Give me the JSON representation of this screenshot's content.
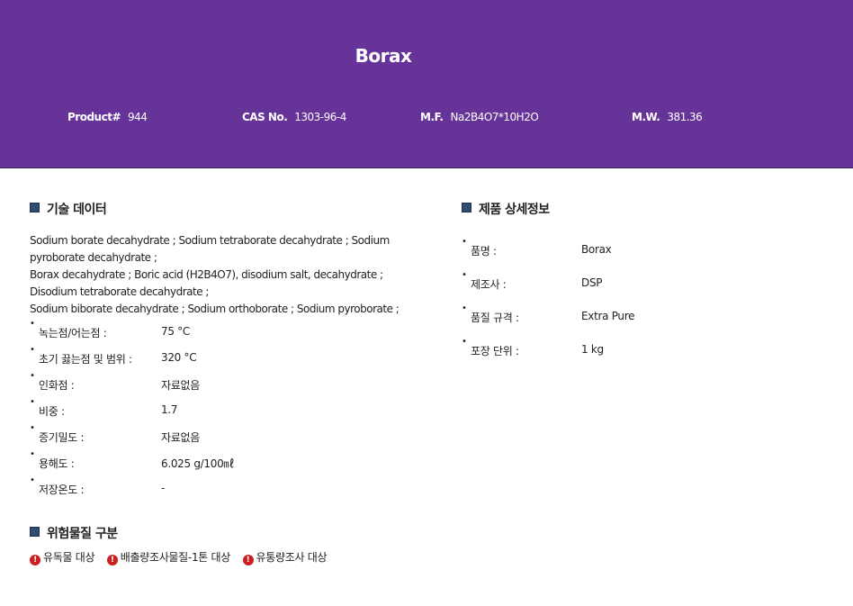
{
  "header": {
    "title": "Borax",
    "product_label": "Product#",
    "product_value": "944",
    "cas_label": "CAS No.",
    "cas_value": "1303-96-4",
    "mf_label": "M.F.",
    "mf_value": "Na2B4O7*10H2O",
    "mw_label": "M.W.",
    "mw_value": "381.36",
    "bg_color": "#663399"
  },
  "tech": {
    "title": "기술 데이터",
    "synonyms": [
      "Sodium borate decahydrate ; Sodium tetraborate decahydrate ; Sodium pyroborate decahydrate ;",
      "Borax decahydrate ; Boric acid (H2B4O7), disodium salt, decahydrate ; Disodium tetraborate decahydrate ;",
      "Sodium biborate decahydrate ; Sodium orthoborate ; Sodium pyroborate ;"
    ],
    "rows": [
      {
        "label": "녹는점/어는점 :",
        "value": "75 °C"
      },
      {
        "label": "초기 끓는점 및 범위 :",
        "value": "320 °C"
      },
      {
        "label": "인화점 :",
        "value": "자료없음"
      },
      {
        "label": "비중 :",
        "value": "1.7"
      },
      {
        "label": "증기밀도 :",
        "value": "자료없음"
      },
      {
        "label": "용해도 :",
        "value": "6.025 g/100㎖"
      },
      {
        "label": "저장온도 :",
        "value": "-"
      }
    ]
  },
  "detail": {
    "title": "제품 상세정보",
    "rows": [
      {
        "label": "품명 :",
        "value": "Borax"
      },
      {
        "label": "제조사 :",
        "value": "DSP"
      },
      {
        "label": "품질 규격 :",
        "value": "Extra Pure"
      },
      {
        "label": "포장 단위 :",
        "value": "1 kg"
      }
    ]
  },
  "hazard": {
    "title": "위험물질 구분",
    "items": [
      "유독물 대상",
      "배출량조사물질-1톤 대상",
      "유통량조사 대상"
    ],
    "icon": "exclamation-circle-icon",
    "icon_color": "#cc1f1f"
  }
}
